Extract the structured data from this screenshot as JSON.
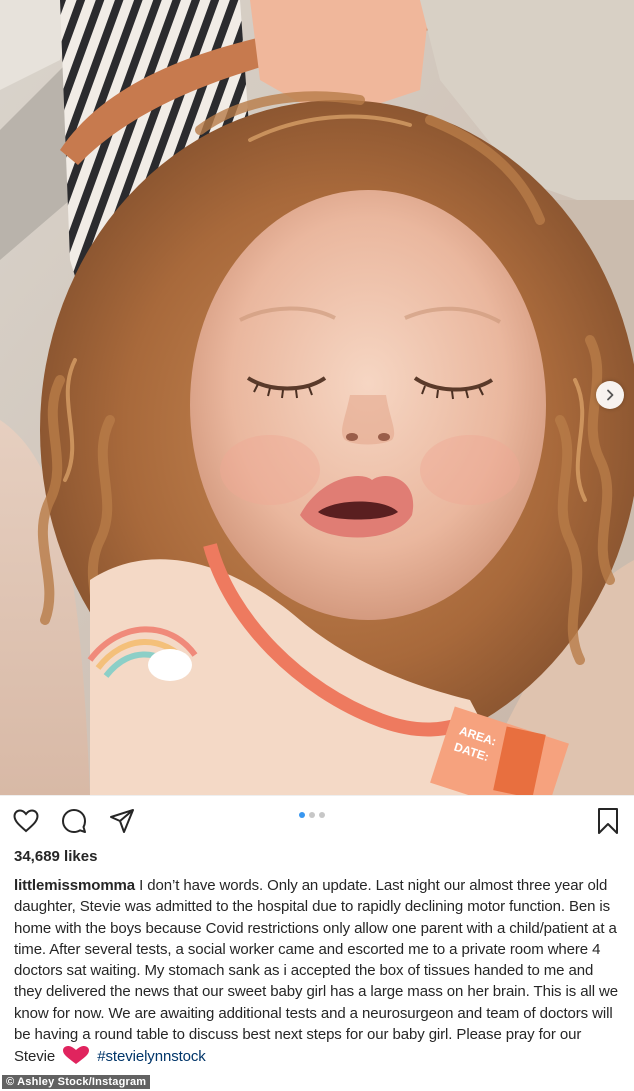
{
  "post": {
    "likes": "34,689 likes",
    "username": "littlemissmomma",
    "caption_text": " I don’t have words. Only an update. Last night our almost three year old daughter, Stevie was admitted to the hospital due to rapidly declining motor function. Ben is home with the boys because Covid restrictions only allow one parent with a child/patient at a time. After several tests, a social worker came and escorted me to a private room where 4 doctors sat waiting. My stomach sank as i accepted the box of tissues handed to me and they delivered the news that our sweet baby girl has a large mass on her brain. This is all we know for now. We are awaiting additional tests and a neurosurgeon and team of doctors will be having a round table to discuss best next steps for our baby girl. Please pray for our Stevie ",
    "hashtag": "#stevielynnstock",
    "carousel": {
      "count": 3,
      "active": 0
    }
  },
  "photo": {
    "sticker_lines": [
      "AREA:",
      "DATE:"
    ]
  },
  "icons": {
    "like": "heart-icon",
    "comment": "comment-icon",
    "share": "paper-plane-icon",
    "save": "bookmark-icon",
    "next": "chevron-right-icon",
    "caption_emoji": "red-heart-icon"
  },
  "credit": "© Ashley Stock/Instagram",
  "colors": {
    "text": "#262626",
    "hashtag": "#003569",
    "dot_active": "#3897f0",
    "dot_inactive": "#c7c7c7",
    "heart": "#e0245e"
  }
}
